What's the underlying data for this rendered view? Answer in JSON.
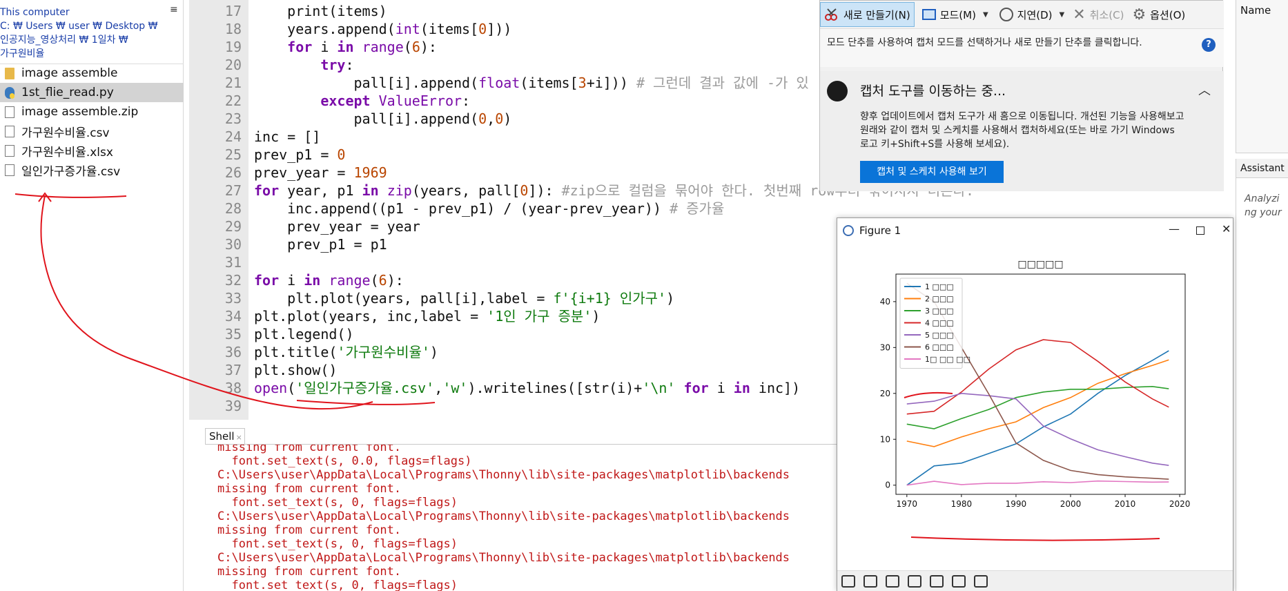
{
  "file_browser": {
    "breadcrumb": "This computer\nC: ₩ Users ₩ user ₩ Desktop ₩\n인공지능_영상처리 ₩ 1일차 ₩\n가구원비율",
    "menu_icon": "≡",
    "items": [
      {
        "label": "image assemble",
        "icon": "folder-icon",
        "selected": false
      },
      {
        "label": "1st_flie_read.py",
        "icon": "python-file-icon",
        "selected": true
      },
      {
        "label": "image assemble.zip",
        "icon": "file-icon",
        "selected": false
      },
      {
        "label": "가구원수비율.csv",
        "icon": "file-icon",
        "selected": false
      },
      {
        "label": "가구원수비율.xlsx",
        "icon": "file-icon",
        "selected": false
      },
      {
        "label": "일인가구증가율.csv",
        "icon": "file-icon",
        "selected": false
      }
    ]
  },
  "editor": {
    "line_numbers": [
      "17",
      "18",
      "19",
      "20",
      "21",
      "22",
      "23",
      "24",
      "25",
      "26",
      "27",
      "28",
      "29",
      "30",
      "31",
      "32",
      "33",
      "34",
      "35",
      "36",
      "37",
      "38",
      "39"
    ],
    "code": {
      "l17": "print(items)",
      "l18a": "years.append(",
      "l18b": "int",
      "l18c": "(items[",
      "l18d": "0",
      "l18e": "]))",
      "l19a": "for",
      "l19b": " i ",
      "l19c": "in",
      "l19d": " ",
      "l19e": "range",
      "l19f": "(",
      "l19g": "6",
      "l19h": "):",
      "l20": "try",
      "l21a": "pall[i].append(",
      "l21b": "float",
      "l21c": "(items[",
      "l21d": "3",
      "l21e": "+i])) ",
      "l21f": "# 그런데 결과 값에 -가 있",
      "l22a": "except",
      "l22b": "ValueError",
      "l23a": "pall[i].append(",
      "l23b": "0",
      "l23c": ",",
      "l23d": "0",
      "l23e": ")",
      "l24": "inc = []",
      "l25a": "prev_p1 = ",
      "l25b": "0",
      "l26a": "prev_year = ",
      "l26b": "1969",
      "l27a": "for",
      "l27b": " year, p1 ",
      "l27c": "in",
      "l27d": "zip",
      "l27e": "(years, pall[",
      "l27f": "0",
      "l27g": "]): ",
      "l27h": "#zip으로 컬럼을 묶어야 한다. 첫번째 row부터 묶이지지 더른다.",
      "l28a": "inc.append((p1 - prev_p1) / (year-prev_year)) ",
      "l28b": "# 증가율",
      "l29": "prev_year = year",
      "l30": "prev_p1 = p1",
      "l32a": "for",
      "l32b": " i ",
      "l32c": "in",
      "l32d": "range",
      "l32e": "(",
      "l32f": "6",
      "l32g": "):",
      "l33a": "plt.plot(years, pall[i],label = ",
      "l33b": "f'{i+1} 인가구'",
      "l33c": ")",
      "l34a": "plt.plot(years, inc,label = ",
      "l34b": "'1인 가구 증분'",
      "l34c": ")",
      "l35": "plt.legend()",
      "l36a": "plt.title(",
      "l36b": "'가구원수비율'",
      "l36c": ")",
      "l37": "plt.show()",
      "l38a": "open",
      "l38b": "(",
      "l38c": "'일인가구증가율.csv'",
      "l38d": ",",
      "l38e": "'w'",
      "l38f": ").writelines([str(i)+",
      "l38g": "'\\n'",
      "l38h": " ",
      "l38i": "for",
      "l38j": " i ",
      "l38k": "in",
      "l38l": " inc])"
    }
  },
  "shell": {
    "tab_label": "Shell",
    "tab_close": "×",
    "lines": [
      "missing from current font.",
      "  font.set_text(s, 0.0, flags=flags)",
      "C:\\Users\\user\\AppData\\Local\\Programs\\Thonny\\lib\\site-packages\\matplotlib\\backends",
      "missing from current font.",
      "  font.set_text(s, 0, flags=flags)",
      "C:\\Users\\user\\AppData\\Local\\Programs\\Thonny\\lib\\site-packages\\matplotlib\\backends",
      "missing from current font.",
      "  font.set_text(s, 0, flags=flags)",
      "C:\\Users\\user\\AppData\\Local\\Programs\\Thonny\\lib\\site-packages\\matplotlib\\backends",
      "missing from current font.",
      "  font.set_text(s, 0, flags=flags)"
    ]
  },
  "snipping_tool": {
    "new_label": "새로 만들기(N)",
    "mode_label": "모드(M)",
    "delay_label": "지연(D)",
    "cancel_label": "취소(C)",
    "options_label": "옵션(O)",
    "info_text": "모드 단추를 사용하여 캡처 모드를 선택하거나 새로 만들기 단추를 클릭합니다.",
    "help": "?",
    "move_title": "캡처 도구를 이동하는 중...",
    "move_body": "향후 업데이트에서 캡처 도구가 새 홈으로 이동됩니다. 개선된 기능을 사용해보고 원래와 같이 캡처 및 스케치를 사용해서 캡처하세요(또는 바로 가기 Windows 로고 키+Shift+S를 사용해 보세요).",
    "move_button": "캡처 및 스케치 사용해 보기"
  },
  "right_panels": {
    "name_label": "Name",
    "assistant_tab": "Assistant",
    "assistant_text": "Analyzi ng your"
  },
  "figure_window": {
    "title": "Figure 1",
    "minimize": "—",
    "close": "✕"
  },
  "chart_data": {
    "type": "line",
    "title": "□□□□□",
    "x": [
      1970,
      1975,
      1980,
      1985,
      1990,
      1995,
      2000,
      2005,
      2010,
      2015,
      2018
    ],
    "xticks": [
      "1970",
      "1980",
      "1990",
      "2000",
      "2010",
      "2020"
    ],
    "yticks": [
      "0",
      "10",
      "20",
      "30",
      "40"
    ],
    "xlim": [
      1968,
      2021
    ],
    "ylim": [
      -2,
      46
    ],
    "legend_placement": "upper-left",
    "series": [
      {
        "name": "1 □□□",
        "color": "#1f77b4",
        "values": [
          0,
          4.2,
          4.8,
          6.9,
          9.0,
          12.7,
          15.5,
          20.0,
          23.9,
          27.2,
          29.3
        ]
      },
      {
        "name": "2 □□□",
        "color": "#ff7f0e",
        "values": [
          9.6,
          8.4,
          10.5,
          12.3,
          13.8,
          16.9,
          19.1,
          22.2,
          24.3,
          26.1,
          27.3
        ]
      },
      {
        "name": "3 □□□",
        "color": "#2ca02c",
        "values": [
          13.3,
          12.3,
          14.5,
          16.5,
          19.1,
          20.3,
          20.9,
          20.9,
          21.3,
          21.5,
          21.0
        ]
      },
      {
        "name": "4 □□□",
        "color": "#d62728",
        "values": [
          15.5,
          16.1,
          20.3,
          25.3,
          29.5,
          31.7,
          31.1,
          27.0,
          22.5,
          18.8,
          17.0
        ]
      },
      {
        "name": "5 □□□",
        "color": "#9467bd",
        "values": [
          17.7,
          18.3,
          20.0,
          19.5,
          18.8,
          12.9,
          10.1,
          7.7,
          6.2,
          4.8,
          4.3
        ]
      },
      {
        "name": "6 □□□",
        "color": "#8c564b",
        "values": [
          44.0,
          40.0,
          30.0,
          19.9,
          9.2,
          5.4,
          3.2,
          2.3,
          1.8,
          1.5,
          1.3
        ]
      },
      {
        "name": "1□ □□ □□",
        "color": "#e377c2",
        "values": [
          0,
          0.84,
          0.12,
          0.42,
          0.42,
          0.74,
          0.56,
          0.9,
          0.78,
          0.66,
          0.7
        ]
      }
    ]
  }
}
